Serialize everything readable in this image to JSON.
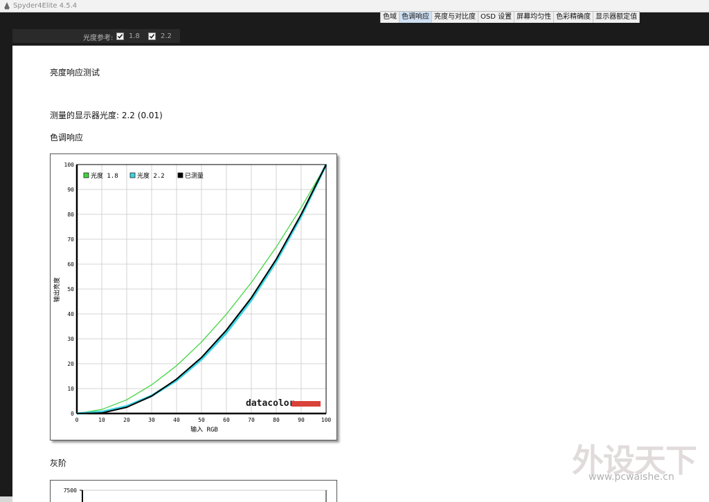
{
  "window": {
    "title": "Spyder4Elite 4.5.4"
  },
  "tabs": [
    {
      "label": "色域",
      "active": false
    },
    {
      "label": "色调响应",
      "active": true
    },
    {
      "label": "亮度与对比度",
      "active": false
    },
    {
      "label": "OSD 设置",
      "active": false
    },
    {
      "label": "屏幕均匀性",
      "active": false
    },
    {
      "label": "色彩精确度",
      "active": false
    },
    {
      "label": "显示器额定值",
      "active": false
    }
  ],
  "gamma_reference": {
    "label": "光度参考:",
    "options": [
      {
        "value": "1.8",
        "checked": true
      },
      {
        "value": "2.2",
        "checked": true
      }
    ]
  },
  "report": {
    "section_title": "亮度响应测试",
    "measured_line": "测量的显示器光度:  2.2 (0.01)",
    "tone_response_title": "色调响应",
    "grayscale_title": "灰阶"
  },
  "colors": {
    "gamma18": "#3fd63f",
    "gamma22": "#39d4e0",
    "measured": "#000000",
    "grid": "#c8c8c8",
    "brand_bar": "#d9423a"
  },
  "chart_data": {
    "type": "line",
    "xlabel": "输入 RGB",
    "ylabel": "输出亮度",
    "xlim": [
      0,
      100
    ],
    "ylim": [
      0,
      100
    ],
    "xticks": [
      0,
      10,
      20,
      30,
      40,
      50,
      60,
      70,
      80,
      90,
      100
    ],
    "yticks": [
      0,
      10,
      20,
      30,
      40,
      50,
      60,
      70,
      80,
      90,
      100
    ],
    "grid": true,
    "legend_position": "top-left",
    "x": [
      0,
      10,
      20,
      30,
      40,
      50,
      60,
      70,
      80,
      90,
      100
    ],
    "series": [
      {
        "name": "光度 1.8",
        "values": [
          0,
          1.6,
          5.5,
          11.5,
          19.2,
          28.7,
          39.9,
          52.6,
          66.9,
          82.7,
          100
        ]
      },
      {
        "name": "光度 2.2",
        "values": [
          0,
          0.6,
          2.9,
          7.1,
          13.3,
          21.8,
          32.5,
          45.6,
          61.2,
          79.3,
          100
        ]
      },
      {
        "name": "已测量",
        "values": [
          0,
          0.2,
          2.5,
          7.0,
          13.8,
          22.5,
          33.5,
          46.5,
          62.0,
          80.0,
          100
        ]
      }
    ],
    "brand": "datacolor"
  },
  "grayscale_chart": {
    "ytick_top": "7500"
  },
  "watermark": {
    "text": "外设天下",
    "url": "www.pcwaishe.cn"
  }
}
